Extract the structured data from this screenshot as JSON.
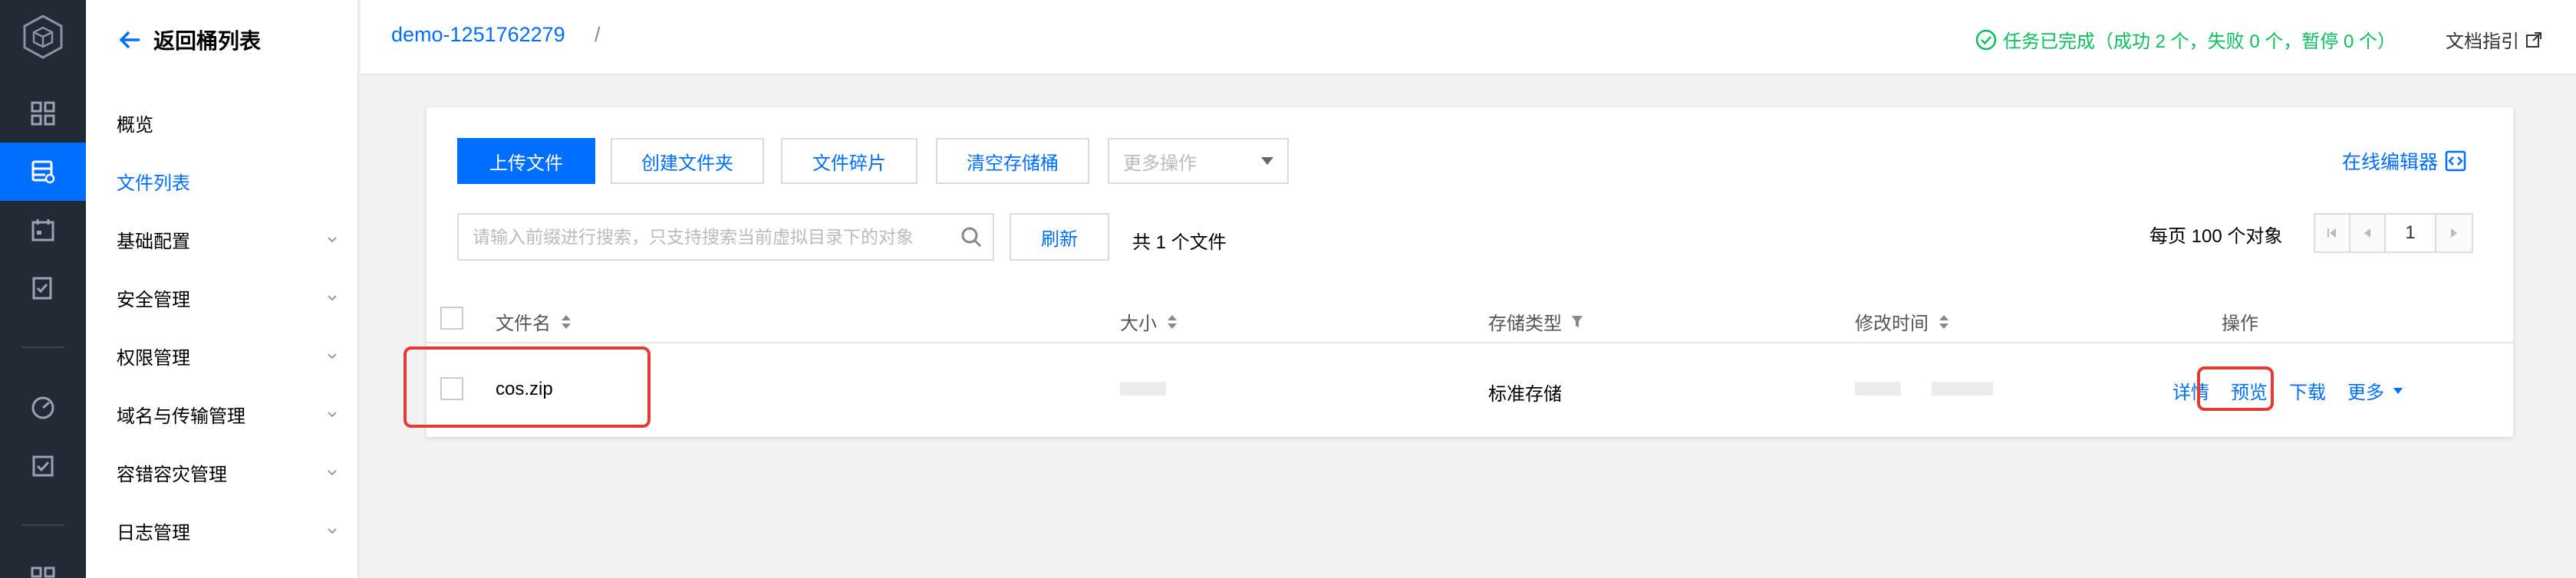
{
  "header": {
    "bucket": "demo-1251762279",
    "separator": "/",
    "task_status": "任务已完成（成功 2 个，失败 0 个，暂停 0 个）",
    "doc_link": "文档指引"
  },
  "sidebar": {
    "back_label": "返回桶列表",
    "items": [
      {
        "label": "概览",
        "active": false,
        "expandable": false
      },
      {
        "label": "文件列表",
        "active": true,
        "expandable": false
      },
      {
        "label": "基础配置",
        "active": false,
        "expandable": true
      },
      {
        "label": "安全管理",
        "active": false,
        "expandable": true
      },
      {
        "label": "权限管理",
        "active": false,
        "expandable": true
      },
      {
        "label": "域名与传输管理",
        "active": false,
        "expandable": true
      },
      {
        "label": "容错容灾管理",
        "active": false,
        "expandable": true
      },
      {
        "label": "日志管理",
        "active": false,
        "expandable": true
      }
    ]
  },
  "toolbar": {
    "upload": "上传文件",
    "create_folder": "创建文件夹",
    "fragments": "文件碎片",
    "clear_bucket": "清空存储桶",
    "more_actions_placeholder": "更多操作",
    "online_editor": "在线编辑器"
  },
  "search": {
    "placeholder": "请输入前缀进行搜索，只支持搜索当前虚拟目录下的对象",
    "refresh": "刷新",
    "count": "共 1 个文件"
  },
  "pagination": {
    "per_page": "每页 100 个对象",
    "current_page": "1"
  },
  "table": {
    "columns": {
      "name": "文件名",
      "size": "大小",
      "storage_class": "存储类型",
      "modified": "修改时间",
      "actions": "操作"
    },
    "rows": [
      {
        "name": "cos.zip",
        "storage_class": "标准存储",
        "actions": [
          "详情",
          "预览",
          "下载",
          "更多"
        ]
      }
    ]
  },
  "colors": {
    "accent": "#006eff",
    "rail_bg": "#232a36",
    "success": "#0abf5b",
    "highlight": "#e53935"
  }
}
